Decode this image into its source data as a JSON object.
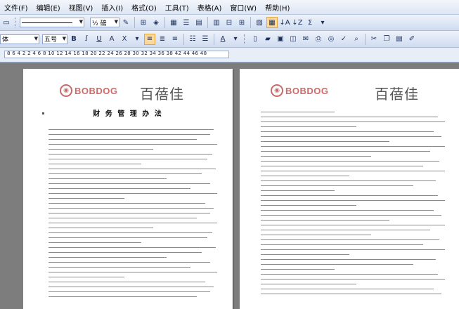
{
  "menu": [
    "文件(F)",
    "编辑(E)",
    "视图(V)",
    "插入(I)",
    "格式(O)",
    "工具(T)",
    "表格(A)",
    "窗口(W)",
    "帮助(H)"
  ],
  "toolbar1": {
    "line_style_label": "",
    "weight_label": "½ 磅"
  },
  "toolbar2": {
    "font_name": "体",
    "font_size": "五号",
    "bold": "B",
    "italic": "I",
    "underline": "U",
    "char_border": "A",
    "font_color_a": "A"
  },
  "ruler": {
    "text": "8  6  4  2  2  4  6  8  10  12  14  16  18  20  22  24  26  28  30  32  34  36  38  42  44  46  48"
  },
  "left_page": {
    "logo_text": "BOBDOG",
    "brand_cn": "百蓓佳",
    "title": "财 务 管 理 办 法"
  },
  "right_page": {
    "logo_text": "BOBDOG",
    "brand_cn": "百蓓佳"
  }
}
